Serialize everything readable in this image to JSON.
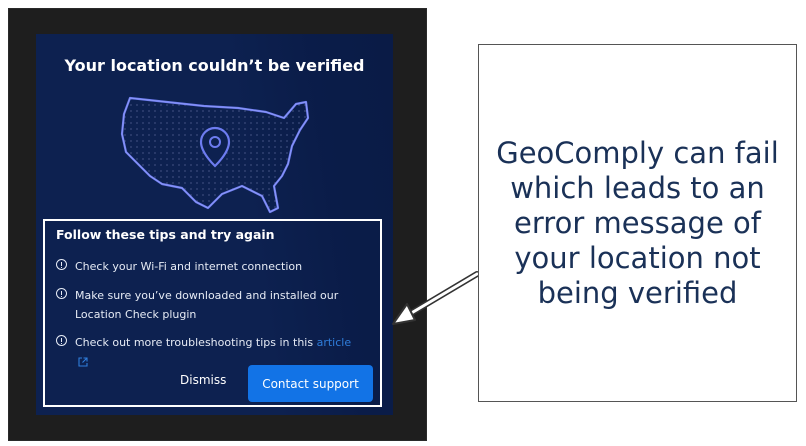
{
  "dialog": {
    "title": "Your location couldn’t be verified",
    "tips_title": "Follow these tips and try again",
    "tips": [
      {
        "text": "Check your Wi-Fi and internet connection",
        "icon": "info-icon"
      },
      {
        "text": "Make sure you’ve downloaded and installed our Location Check plugin",
        "icon": "info-icon"
      },
      {
        "text": "Check out more troubleshooting tips in this",
        "link": "article",
        "icon": "info-icon"
      }
    ],
    "dismiss_label": "Dismiss",
    "contact_label": "Contact support",
    "colors": {
      "background": "#0d2150",
      "accent": "#1273e6",
      "map_outline": "#6d7cf0",
      "link": "#2f7ddb"
    }
  },
  "callout": {
    "text": "GeoComply can fail which leads to an error message of your location not being verified",
    "color": "#1a3157"
  }
}
